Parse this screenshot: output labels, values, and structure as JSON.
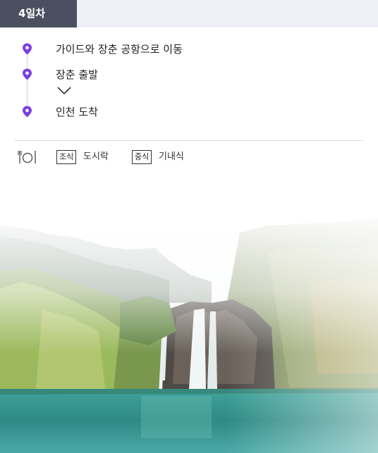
{
  "day": {
    "label": "4일차"
  },
  "timeline": {
    "stops": [
      {
        "label": "가이드와 장춘 공항으로 이동"
      },
      {
        "label": "장춘 출발"
      },
      {
        "label": "인천 도착"
      }
    ],
    "pin_color": "#7b3fe4"
  },
  "meals": {
    "breakfast": {
      "tag": "조식",
      "value": "도시락"
    },
    "lunch": {
      "tag": "중식",
      "value": "기내식"
    }
  },
  "photo": {
    "subject": "waterfall-lake-landscape"
  }
}
